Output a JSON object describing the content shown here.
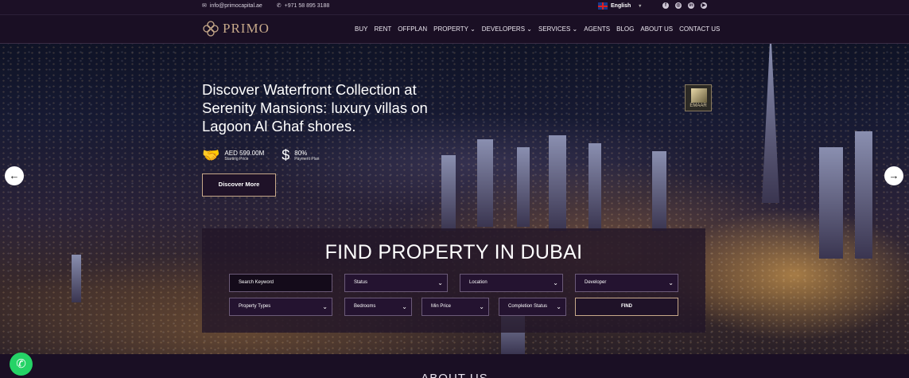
{
  "topbar": {
    "email": "info@primocapital.ae",
    "phone": "+971 58 895 3188",
    "language": "English",
    "social_icons": [
      "facebook-icon",
      "instagram-icon",
      "linkedin-icon",
      "youtube-icon"
    ]
  },
  "nav": {
    "logo_text": "PRIMO",
    "items": [
      "BUY",
      "RENT",
      "OFFPLAN",
      "PROPERTY",
      "DEVELOPERS",
      "SERVICES",
      "AGENTS",
      "BLOG",
      "ABOUT US",
      "CONTACT US"
    ]
  },
  "hero": {
    "title": "Discover Waterfront Collection at Serenity Mansions: luxury villas on Lagoon Al Ghaf shores.",
    "price_value": "AED 599.00M",
    "price_label": "Starting Price",
    "plan_value": "80%",
    "plan_label": "Payment Plan",
    "cta": "Discover More",
    "developer_logo": "EMAAR"
  },
  "search": {
    "heading": "FIND PROPERTY IN DUBAI",
    "keyword": "Search Keyword",
    "status": "Status",
    "location": "Location",
    "developer": "Developer",
    "property_types": "Property Types",
    "bedrooms": "Bedrooms",
    "min_price": "Min Price",
    "completion_status": "Completion Status",
    "find": "FIND"
  },
  "section": {
    "about_heading": "ABOUT US"
  },
  "colors": {
    "background": "#1a0f24",
    "accent_gold": "#c7a98a",
    "whatsapp": "#25d366"
  }
}
